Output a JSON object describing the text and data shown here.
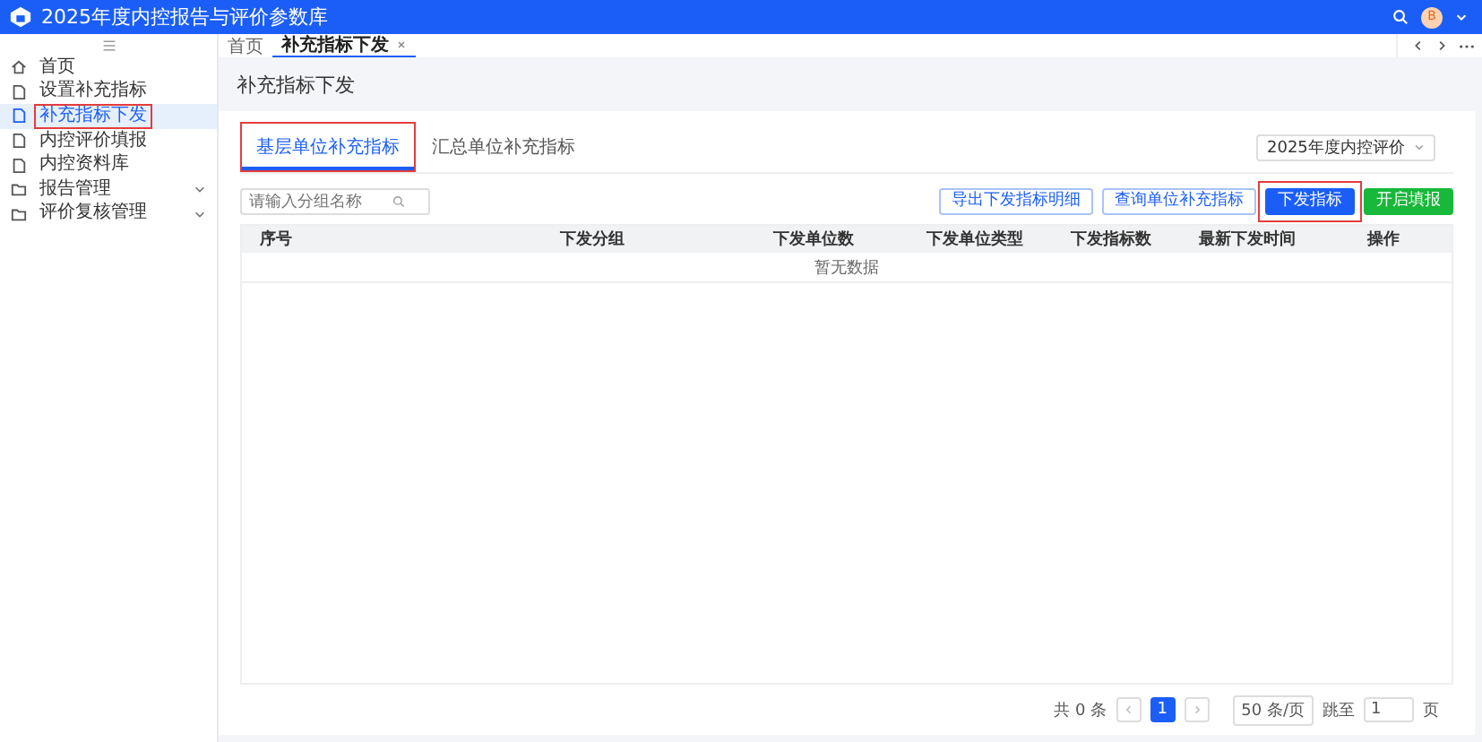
{
  "app": {
    "title": "2025年度内控报告与评价参数库",
    "avatar": "B"
  },
  "sidebar": {
    "items": [
      {
        "label": "首页",
        "kind": "home",
        "selected": false,
        "highlighted": false,
        "expandable": false
      },
      {
        "label": "设置补充指标",
        "kind": "doc",
        "selected": false,
        "highlighted": false,
        "expandable": false
      },
      {
        "label": "补充指标下发",
        "kind": "doc",
        "selected": true,
        "highlighted": true,
        "expandable": false
      },
      {
        "label": "内控评价填报",
        "kind": "doc",
        "selected": false,
        "highlighted": false,
        "expandable": false
      },
      {
        "label": "内控资料库",
        "kind": "doc",
        "selected": false,
        "highlighted": false,
        "expandable": false
      },
      {
        "label": "报告管理",
        "kind": "folder",
        "selected": false,
        "highlighted": false,
        "expandable": true
      },
      {
        "label": "评价复核管理",
        "kind": "folder",
        "selected": false,
        "highlighted": false,
        "expandable": true
      }
    ]
  },
  "page_tabs": [
    {
      "label": "首页",
      "selected": false,
      "closable": false
    },
    {
      "label": "补充指标下发",
      "selected": true,
      "closable": true
    }
  ],
  "page_title": "补充指标下发",
  "tabs": [
    {
      "label": "基层单位补充指标",
      "selected": true,
      "highlighted": true
    },
    {
      "label": "汇总单位补充指标",
      "selected": false,
      "highlighted": false
    }
  ],
  "year_select": {
    "value": "2025年度内控评价"
  },
  "search": {
    "placeholder": "请输入分组名称"
  },
  "buttons": [
    {
      "label": "导出下发指标明细",
      "kind": "outline",
      "highlighted": false
    },
    {
      "label": "查询单位补充指标",
      "kind": "outline",
      "highlighted": false
    },
    {
      "label": "下发指标",
      "kind": "primary",
      "highlighted": true
    },
    {
      "label": "开启填报",
      "kind": "success",
      "highlighted": false
    }
  ],
  "table": {
    "columns": [
      "序号",
      "下发分组",
      "下发单位数",
      "下发单位类型",
      "下发指标数",
      "最新下发时间",
      "操作"
    ],
    "empty_text": "暂无数据"
  },
  "pagination": {
    "total": "共 0 条",
    "pages": [
      {
        "label": "1",
        "selected": true
      }
    ],
    "page_size": "50 条/页",
    "goto_label": "跳至",
    "goto_value": "1",
    "page_suffix": "页"
  }
}
